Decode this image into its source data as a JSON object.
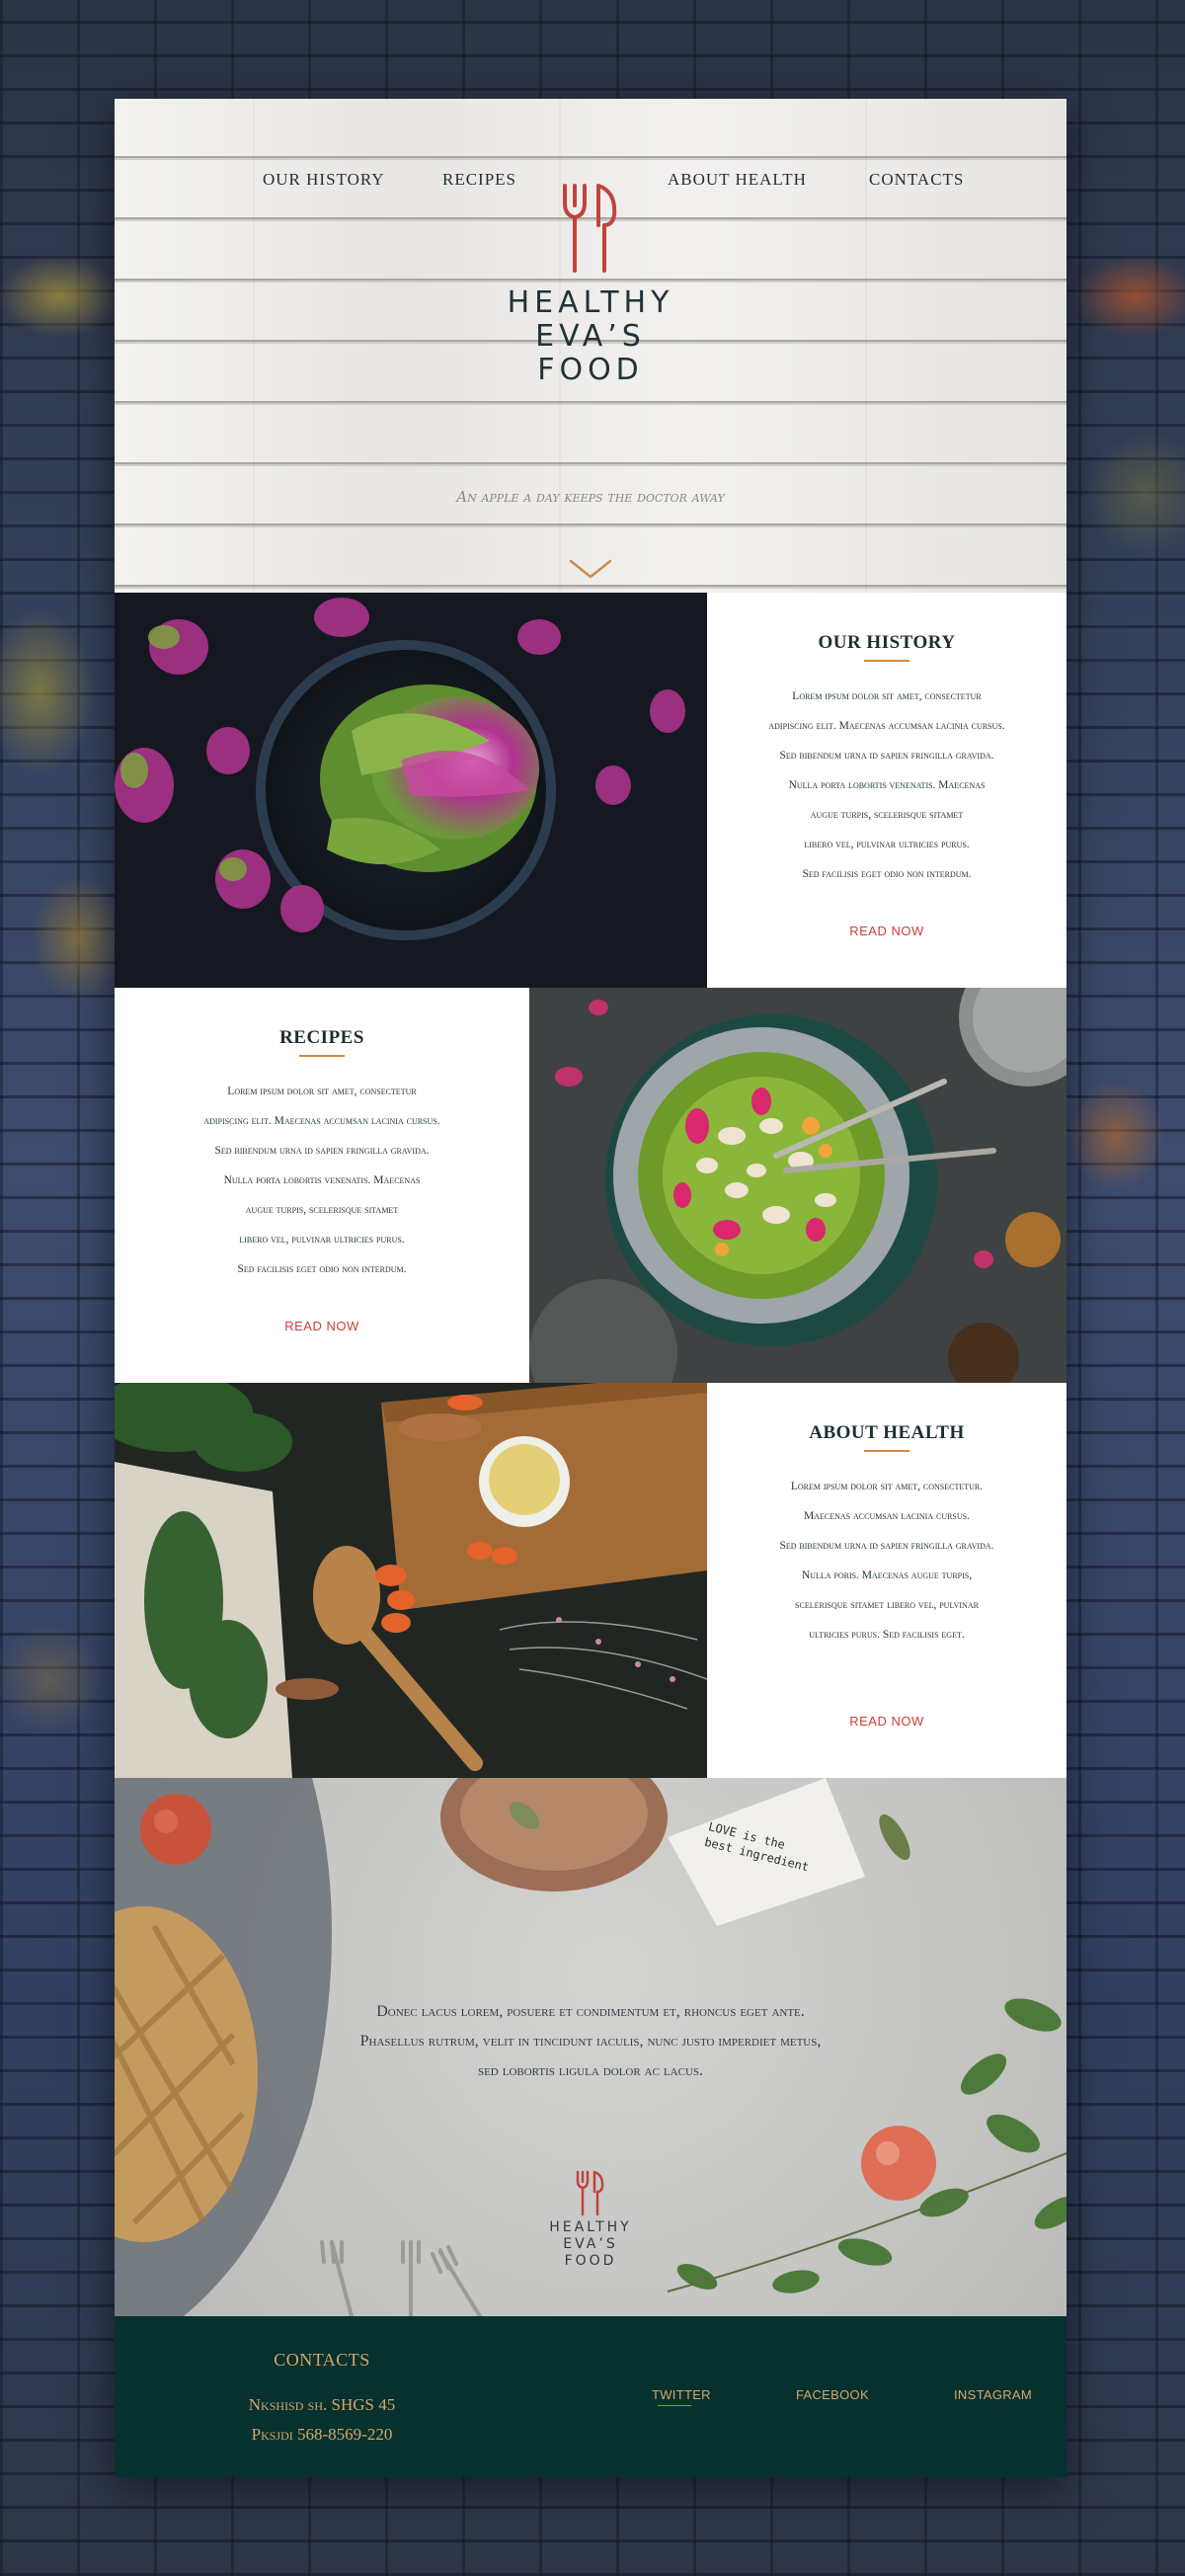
{
  "nav": {
    "items": [
      "OUR HISTORY",
      "RECIPES",
      "ABOUT HEALTH",
      "CONTACTS"
    ]
  },
  "logo": {
    "line1": "HEALTHY",
    "line2": "EVA’S",
    "line3": "FOOD"
  },
  "hero": {
    "tagline": "An apple a day keeps the doctor away"
  },
  "sections": [
    {
      "title": "OUR HISTORY",
      "body": "Lorem ipsum dolor sit amet, consectetur\nadipiscing elit. Maecenas accumsan lacinia cursus.\nSed bibendum urna id sapien fringilla gravida.\nNulla porta lobortis venenatis. Maecenas\naugue turpis, scelerisque sitamet\nlibero vel, pulvinar ultricies purus.\nSed facilisis eget odio non interdum.",
      "cta": "READ NOW"
    },
    {
      "title": "RECIPES",
      "body": "Lorem ipsum dolor sit amet, consectetur\nadipiscing elit. Maecenas accumsan lacinia cursus.\nSed bibendum urna id sapien fringilla gravida.\nNulla porta lobortis venenatis. Maecenas\naugue turpis, scelerisque sitamet\nlibero vel, pulvinar ultricies purus.\nSed facilisis eget odio non interdum.",
      "cta": "READ NOW"
    },
    {
      "title": "ABOUT HEALTH",
      "body": "Lorem ipsum dolor sit amet, consectetur.\nMaecenas accumsan lacinia cursus.\nSed bibendum urna id sapien fringilla gravida.\nNulla poris. Maecenas augue turpis,\nscelerisque sitamet libero vel, pulvinar\nultricies purus. Sed facilisis eget.",
      "cta": "READ NOW"
    }
  ],
  "closing": {
    "text": "Donec lacus lorem, posuere et condimentum et, rhoncus eget ante.\nPhasellus rutrum, velit in tincidunt iaculis, nunc justo imperdiet metus,\nsed lobortis ligula dolor ac lacus.",
    "napkin_text": "LOVE is the best ingredient"
  },
  "footer": {
    "title": "CONTACTS",
    "address": "Nkshisd sh. SHGS 45",
    "phone": "Pksjdi 568-8569-220",
    "social": [
      "TWITTER",
      "FACEBOOK",
      "INSTAGRAM"
    ]
  },
  "colors": {
    "accent_red": "#c9403a",
    "accent_orange": "#d8883e",
    "footer_bg": "#07312e",
    "footer_text": "#d7a66a",
    "text_dark": "#1c2e32"
  },
  "icons": [
    "fork-logo-icon",
    "chevron-down-icon"
  ]
}
